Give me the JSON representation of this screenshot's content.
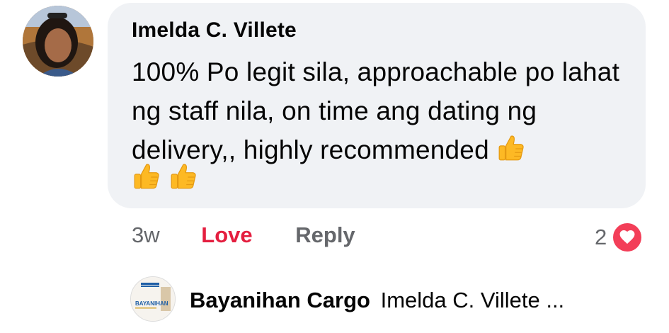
{
  "comment": {
    "author": "Imelda C. Villete",
    "text": "100% Po legit sila, approachable po lahat ng staff nila, on time ang dating ng delivery,, highly recommended",
    "emojis": [
      "thumbs-up",
      "thumbs-up",
      "thumbs-up"
    ],
    "time": "3w",
    "love_label": "Love",
    "reply_label": "Reply",
    "reaction_count": "2",
    "reaction_type": "heart"
  },
  "reply": {
    "author": "Bayanihan Cargo",
    "preview": "Imelda C. Villete ..."
  },
  "colors": {
    "bubble": "#f0f2f5",
    "love": "#e41e3f",
    "muted": "#65676b",
    "heart": "#f33e58"
  }
}
